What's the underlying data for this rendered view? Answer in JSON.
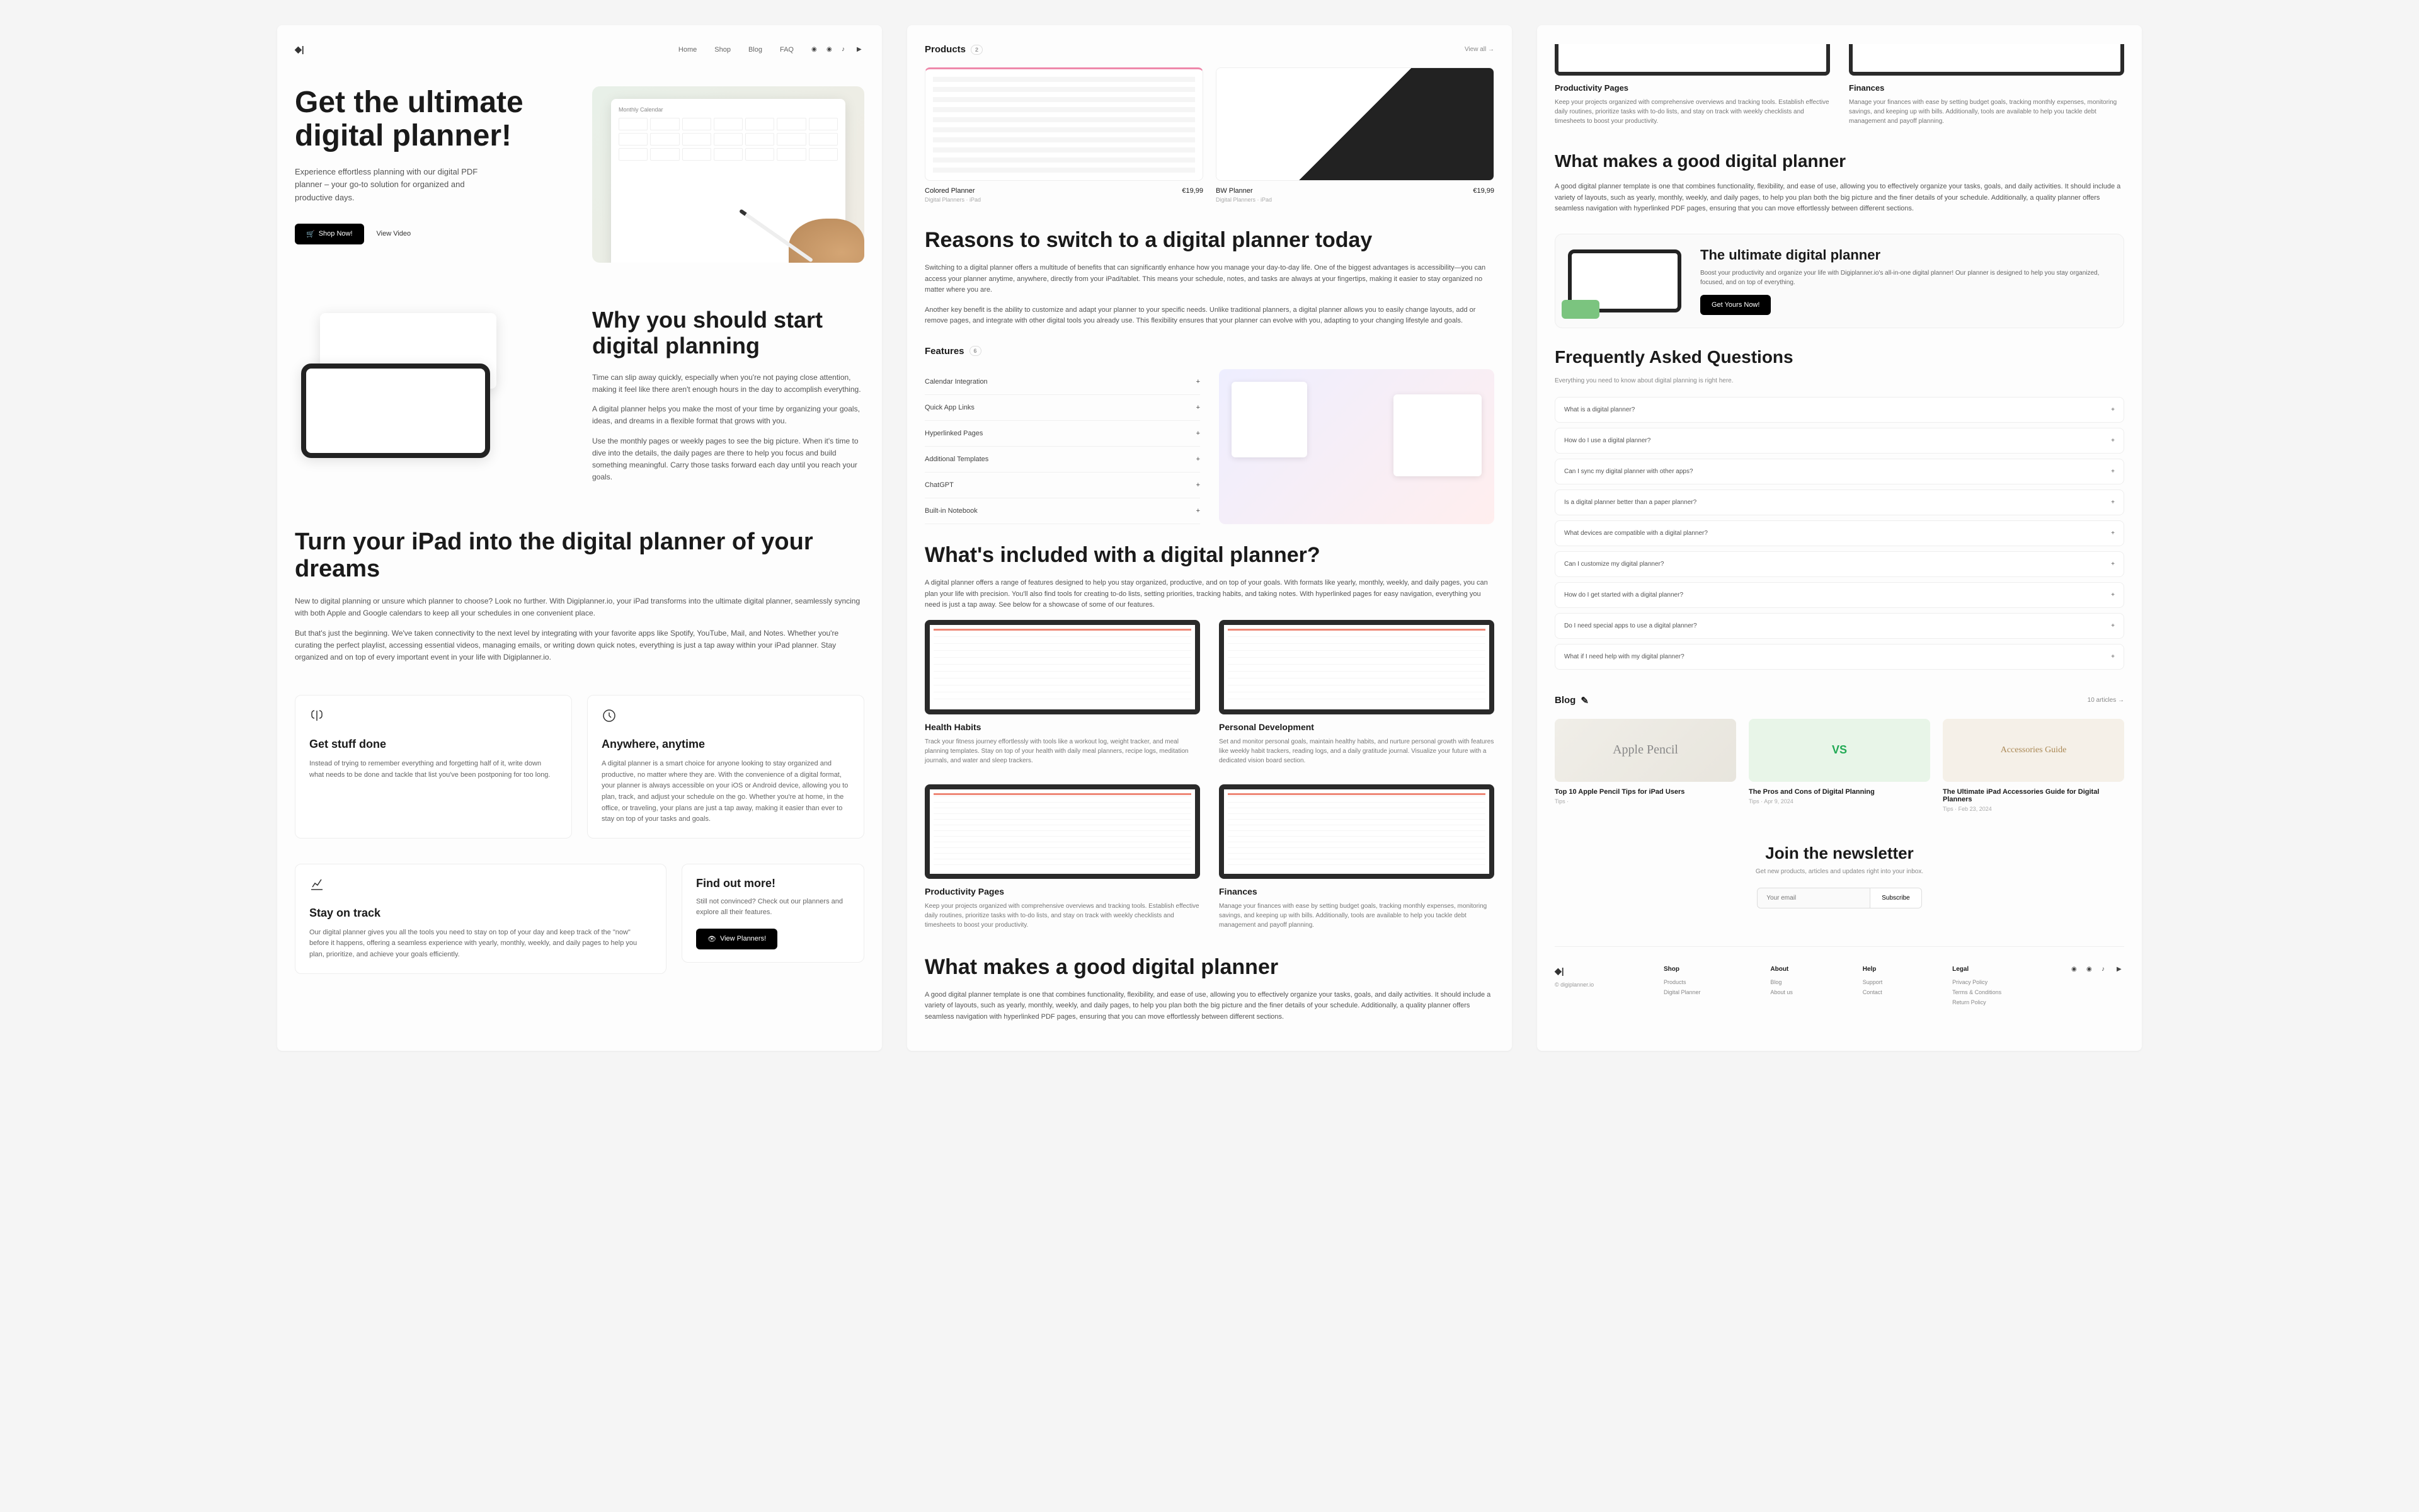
{
  "nav": {
    "home": "Home",
    "shop": "Shop",
    "blog": "Blog",
    "faq": "FAQ"
  },
  "hero": {
    "title": "Get the ultimate digital planner!",
    "desc": "Experience effortless planning with our digital PDF planner – your go-to solution for organized and productive days.",
    "btn": "Shop Now!",
    "link": "View Video",
    "mock_title": "Monthly Calendar"
  },
  "sect2": {
    "title": "Why you should start digital planning",
    "p1": "Time can slip away quickly, especially when you're not paying close attention, making it feel like there aren't enough hours in the day to accomplish everything.",
    "p2": "A digital planner helps you make the most of your time by organizing your goals, ideas, and dreams in a flexible format that grows with you.",
    "p3": "Use the monthly pages or weekly pages to see the big picture. When it's time to dive into the details, the daily pages are there to help you focus and build something meaningful. Carry those tasks forward each day until you reach your goals."
  },
  "sect3": {
    "title": "Turn your iPad into the digital planner of your dreams",
    "p1": "New to digital planning or unsure which planner to choose? Look no further. With Digiplanner.io, your iPad transforms into the ultimate digital planner, seamlessly syncing with both Apple and Google calendars to keep all your schedules in one convenient place.",
    "p2": "But that's just the beginning. We've taken connectivity to the next level by integrating with your favorite apps like Spotify, YouTube, Mail, and Notes. Whether you're curating the perfect playlist, accessing essential videos, managing emails, or writing down quick notes, everything is just a tap away within your iPad planner. Stay organized and on top of every important event in your life with Digiplanner.io."
  },
  "features": [
    {
      "title": "Get stuff done",
      "desc": "Instead of trying to remember everything and forgetting half of it, write down what needs to be done and tackle that list you've been postponing for too long."
    },
    {
      "title": "Anywhere, anytime",
      "desc": "A digital planner is a smart choice for anyone looking to stay organized and productive, no matter where they are. With the convenience of a digital format, your planner is always accessible on your iOS or Android device, allowing you to plan, track, and adjust your schedule on the go. Whether you're at home, in the office, or traveling, your plans are just a tap away, making it easier than ever to stay on top of your tasks and goals."
    },
    {
      "title": "Stay on track",
      "desc": "Our digital planner gives you all the tools you need to stay on top of your day and keep track of the \"now\" before it happens, offering a seamless experience with yearly, monthly, weekly, and daily pages to help you plan, prioritize, and achieve your goals efficiently."
    }
  ],
  "findout": {
    "title": "Find out more!",
    "desc": "Still not convinced? Check out our planners and explore all their features.",
    "btn": "View Planners!"
  },
  "products": {
    "title": "Products",
    "viewall": "View all",
    "items": [
      {
        "name": "Colored Planner",
        "price": "€19,99",
        "cat": "Digital Planners",
        "type": "iPad"
      },
      {
        "name": "BW Planner",
        "price": "€19,99",
        "cat": "Digital Planners",
        "type": "iPad"
      }
    ]
  },
  "reasons": {
    "title": "Reasons to switch to a digital planner today",
    "p1": "Switching to a digital planner offers a multitude of benefits that can significantly enhance how you manage your day-to-day life. One of the biggest advantages is accessibility—you can access your planner anytime, anywhere, directly from your iPad/tablet. This means your schedule, notes, and tasks are always at your fingertips, making it easier to stay organized no matter where you are.",
    "p2": "Another key benefit is the ability to customize and adapt your planner to your specific needs. Unlike traditional planners, a digital planner allows you to easily change layouts, add or remove pages, and integrate with other digital tools you already use. This flexibility ensures that your planner can evolve with you, adapting to your changing lifestyle and goals."
  },
  "facc": {
    "title": "Features",
    "items": [
      "Calendar Integration",
      "Quick App Links",
      "Hyperlinked Pages",
      "Additional Templates",
      "ChatGPT",
      "Built-in Notebook"
    ]
  },
  "included": {
    "title": "What's included with a digital planner?",
    "desc": "A digital planner offers a range of features designed to help you stay organized, productive, and on top of your goals. With formats like yearly, monthly, weekly, and daily pages, you can plan your life with precision. You'll also find tools for creating to-do lists, setting priorities, tracking habits, and taking notes. With hyperlinked pages for easy navigation, everything you need is just a tap away. See below for a showcase of some of our features.",
    "items": [
      {
        "title": "Health Habits",
        "desc": "Track your fitness journey effortlessly with tools like a workout log, weight tracker, and meal planning templates. Stay on top of your health with daily meal planners, recipe logs, meditation journals, and water and sleep trackers."
      },
      {
        "title": "Personal Development",
        "desc": "Set and monitor personal goals, maintain healthy habits, and nurture personal growth with features like weekly habit trackers, reading logs, and a daily gratitude journal. Visualize your future with a dedicated vision board section."
      },
      {
        "title": "Productivity Pages",
        "desc": "Keep your projects organized with comprehensive overviews and tracking tools. Establish effective daily routines, prioritize tasks with to-do lists, and stay on track with weekly checklists and timesheets to boost your productivity."
      },
      {
        "title": "Finances",
        "desc": "Manage your finances with ease by setting budget goals, tracking monthly expenses, monitoring savings, and keeping up with bills. Additionally, tools are available to help you tackle debt management and payoff planning."
      }
    ]
  },
  "goodplanner": {
    "title": "What makes a good digital planner",
    "title2": "What makes a good digital planner",
    "p1": "A good digital planner template is one that combines functionality, flexibility, and ease of use, allowing you to effectively organize your tasks, goals, and daily activities. It should include a variety of layouts, such as yearly, monthly, weekly, and daily pages, to help you plan both the big picture and the finer details of your schedule. Additionally, a quality planner offers seamless navigation with hyperlinked PDF pages, ensuring that you can move effortlessly between different sections."
  },
  "cta": {
    "title": "The ultimate digital planner",
    "desc": "Boost your productivity and organize your life with Digiplanner.io's all-in-one digital planner! Our planner is designed to help you stay organized, focused, and on top of everything.",
    "btn": "Get Yours Now!"
  },
  "faq": {
    "title": "Frequently Asked Questions",
    "sub": "Everything you need to know about digital planning is right here.",
    "items": [
      "What is a digital planner?",
      "How do I use a digital planner?",
      "Can I sync my digital planner with other apps?",
      "Is a digital planner better than a paper planner?",
      "What devices are compatible with a digital planner?",
      "Can I customize my digital planner?",
      "How do I get started with a digital planner?",
      "Do I need special apps to use a digital planner?",
      "What if I need help with my digital planner?"
    ]
  },
  "blog": {
    "title": "Blog",
    "count": "10 articles",
    "items": [
      {
        "title": "Top 10 Apple Pencil Tips for iPad Users",
        "cat": "Tips",
        "date": ""
      },
      {
        "title": "The Pros and Cons of Digital Planning",
        "cat": "Tips",
        "date": "Apr 9, 2024"
      },
      {
        "title": "The Ultimate iPad Accessories Guide for Digital Planners",
        "cat": "Tips",
        "date": "Feb 23, 2024"
      }
    ],
    "img1": "Apple Pencil",
    "img2": "VS",
    "img3": "Accessories Guide"
  },
  "newsletter": {
    "title": "Join the newsletter",
    "desc": "Get new products, articles and updates right into your inbox.",
    "placeholder": "Your email",
    "btn": "Subscribe"
  },
  "footer": {
    "brand": "digiplanner.io",
    "cols": [
      {
        "title": "Shop",
        "links": [
          "Products",
          "Digital Planner"
        ]
      },
      {
        "title": "About",
        "links": [
          "Blog",
          "About us"
        ]
      },
      {
        "title": "Help",
        "links": [
          "Support",
          "Contact"
        ]
      },
      {
        "title": "Legal",
        "links": [
          "Privacy Policy",
          "Terms & Conditions",
          "Return Policy"
        ]
      }
    ]
  }
}
